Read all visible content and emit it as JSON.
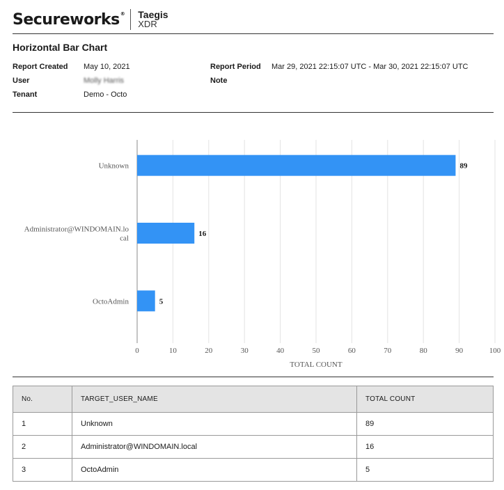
{
  "brand": {
    "name": "Secureworks",
    "product": "Taegis",
    "product_sub": "XDR"
  },
  "report": {
    "title": "Horizontal Bar Chart",
    "created_label": "Report Created",
    "created_value": "May 10, 2021",
    "user_label": "User",
    "user_value": "Molly Harris",
    "tenant_label": "Tenant",
    "tenant_value": "Demo - Octo",
    "period_label": "Report Period",
    "period_value": "Mar 29, 2021 22:15:07 UTC - Mar 30, 2021 22:15:07 UTC",
    "note_label": "Note"
  },
  "chart_data": {
    "type": "bar",
    "orientation": "horizontal",
    "categories": [
      "Unknown",
      "Administrator@WINDOMAIN.local",
      "OctoAdmin"
    ],
    "category_display": [
      [
        "Unknown"
      ],
      [
        "Administrator@WINDOMAIN.lo",
        "cal"
      ],
      [
        "OctoAdmin"
      ]
    ],
    "values": [
      89,
      16,
      5
    ],
    "xlabel": "TOTAL COUNT",
    "xlim": [
      0,
      100
    ],
    "xticks": [
      0,
      10,
      20,
      30,
      40,
      50,
      60,
      70,
      80,
      90,
      100
    ],
    "grid": true,
    "bar_color": "#3393f5"
  },
  "table": {
    "headers": [
      "No.",
      "TARGET_USER_NAME",
      "TOTAL COUNT"
    ],
    "rows": [
      [
        "1",
        "Unknown",
        "89"
      ],
      [
        "2",
        "Administrator@WINDOMAIN.local",
        "16"
      ],
      [
        "3",
        "OctoAdmin",
        "5"
      ]
    ]
  }
}
